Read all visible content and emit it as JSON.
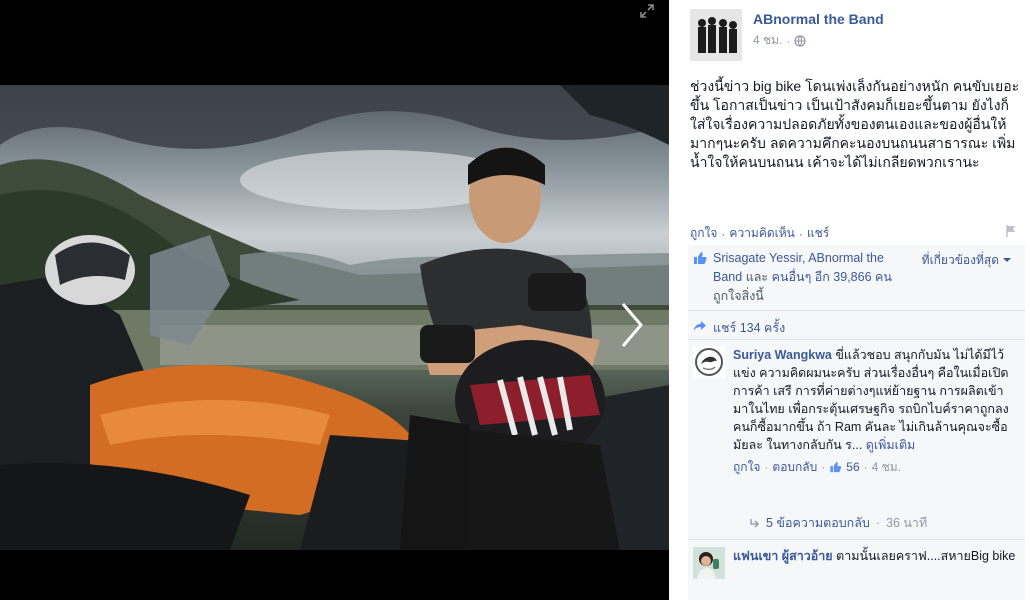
{
  "viewer": {
    "expand_icon": "expand-arrows-icon",
    "next_icon": "chevron-right-icon"
  },
  "post": {
    "author": "ABnormal the Band",
    "time": "4 ชม.",
    "privacy_icon": "globe-icon",
    "text": "ช่วงนี้ข่าว big bike โดนเพ่งเล็งกันอย่างหนัก คนขับเยอะขึ้น โอกาสเป็นข่าว เป็นเป้าสังคมก็เยอะขึ้นตาม ยังไงก็ใส่ใจเรื่องความปลอดภัยทั้งของตนเองและของผู้อื่นให้มากๆนะครับ ลดความคึกคะนองบนถนนสาธารณะ เพิ่มน้ำใจให้คนบนถนน เค้าจะได้ไม่เกลียดพวกเรานะ",
    "actions": {
      "like": "ถูกใจ",
      "comment": "ความคิดเห็น",
      "share": "แชร์",
      "separator": "·"
    }
  },
  "likes": {
    "line1_names": "Srisagate Yessir, ABnormal the Band",
    "line2_connector": "และ",
    "line2_others": "คนอื่นๆ อีก 39,866 คน",
    "line3_suffix": "ถูกใจสิ่งนี้",
    "sort_label": "ที่เกี่ยวข้องที่สุด"
  },
  "shares": {
    "label": "แชร์ 134 ครั้ง"
  },
  "comments": [
    {
      "author": "Suriya Wangkwa",
      "text": "ขี่แล้วชอบ สนุกกับมัน ไม่ได้มีไว้แข่ง ความคิดผมนะครับ ส่วนเรื่องอื่นๆ คือในเมื่อเปิดการค้า เสรี การที่ค่ายต่างๆแห่ย้ายฐาน การผลิตเข้ามาในไทย เพื่อกระตุ้นเศรษฐกิจ รถบิกไบค์ราคาถูกลง คนก็ซื้อมากขึ้น ถ้า Ram คันละ ไม่เกินล้านคุณจะซื้อมัยละ ในทางกลับกัน ร...",
      "see_more": "ดูเพิ่มเติม",
      "like_label": "ถูกใจ",
      "reply_label": "ตอบกลับ",
      "like_count": "56",
      "time": "4 ชม."
    },
    {
      "author": "แฟนเขา ผู้สาวอ้าย",
      "text": "ตามนั้นเลยคราฟ....สหายBig bike"
    }
  ],
  "replies": {
    "label": "5 ข้อความตอบกลับ",
    "time": "36 นาที"
  },
  "colors": {
    "link": "#3b5998",
    "meta": "#9197a3",
    "ufi_bg": "#f6f7f9"
  }
}
